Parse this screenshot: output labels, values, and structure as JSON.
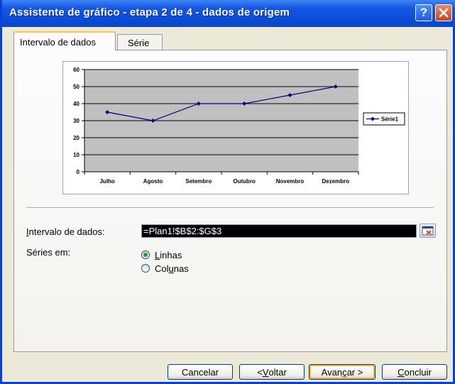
{
  "window": {
    "title": "Assistente de gráfico - etapa 2 de 4 - dados de origem",
    "help_glyph": "?",
    "close_icon": "close-icon"
  },
  "tabs": [
    {
      "label": "Intervalo de dados",
      "active": true
    },
    {
      "label": "Série",
      "active": false
    }
  ],
  "chart_data": {
    "type": "line",
    "categories": [
      "Julho",
      "Agosto",
      "Setembro",
      "Outubro",
      "Novembro",
      "Dezembro"
    ],
    "series": [
      {
        "name": "Série1",
        "values": [
          35,
          30,
          40,
          40,
          45,
          50
        ]
      }
    ],
    "ylim": [
      0,
      60
    ],
    "yticks": [
      "0",
      "10",
      "20",
      "30",
      "40",
      "50",
      "60"
    ],
    "grid": true,
    "legend": "right",
    "colors": {
      "plot_area": "#c0c0c0",
      "series": "#000080"
    }
  },
  "form": {
    "range_label": "Intervalo de dados:",
    "range_value": "=Plan1!$B$2:$G$3",
    "series_in_label": "Séries em:",
    "options": [
      {
        "label": "Linhas",
        "selected": true
      },
      {
        "label": "Colunas",
        "selected": false
      }
    ]
  },
  "buttons": {
    "cancel": "Cancelar",
    "back": "< Voltar",
    "next": "Avançar >",
    "finish": "Concluir"
  }
}
